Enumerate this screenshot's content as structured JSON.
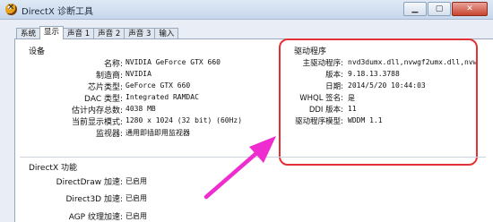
{
  "window": {
    "title": "DirectX 诊断工具"
  },
  "tabs": [
    "系统",
    "显示",
    "声音 1",
    "声音 2",
    "声音 3",
    "输入"
  ],
  "device": {
    "section_title": "设备",
    "fields": [
      {
        "label": "名称:",
        "value": "NVIDIA GeForce GTX 660"
      },
      {
        "label": "制造商:",
        "value": "NVIDIA"
      },
      {
        "label": "芯片类型:",
        "value": "GeForce GTX 660"
      },
      {
        "label": "DAC 类型:",
        "value": "Integrated RAMDAC"
      },
      {
        "label": "估计内存总数:",
        "value": "4038 MB"
      },
      {
        "label": "当前显示模式:",
        "value": "1280 x 1024 (32 bit) (60Hz)"
      },
      {
        "label": "监视器:",
        "value": "通用即插即用监视器"
      }
    ]
  },
  "driver": {
    "section_title": "驱动程序",
    "fields": [
      {
        "label": "主驱动程序:",
        "value": "nvd3dumx.dll,nvwgf2umx.dll,nvw"
      },
      {
        "label": "版本:",
        "value": "9.18.13.3788"
      },
      {
        "label": "日期:",
        "value": "2014/5/20 10:44:03"
      },
      {
        "label": "WHQL 签名:",
        "value": "是"
      },
      {
        "label": "DDI 版本:",
        "value": "11"
      },
      {
        "label": "驱动程序模型:",
        "value": "WDDM 1.1"
      }
    ]
  },
  "directx": {
    "section_title": "DirectX 功能",
    "fields": [
      {
        "label": "DirectDraw 加速:",
        "value": "已启用"
      },
      {
        "label": "Direct3D 加速:",
        "value": "已启用"
      },
      {
        "label": "AGP 纹理加速:",
        "value": "已启用"
      }
    ]
  },
  "colors": {
    "highlight": "#e33236",
    "arrow": "#ee2ccf"
  }
}
